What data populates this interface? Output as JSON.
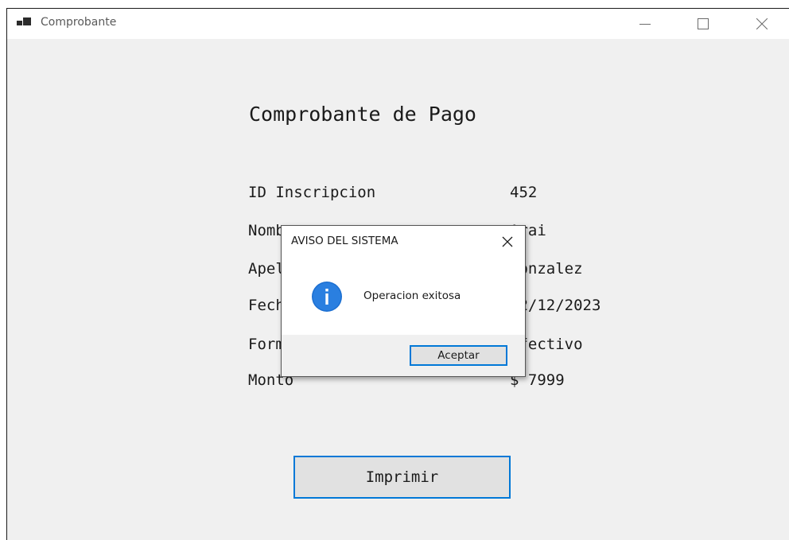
{
  "window": {
    "title": "Comprobante",
    "icon": "app-window-icon",
    "controls": [
      "minimize-icon",
      "maximize-icon",
      "close-icon"
    ]
  },
  "form": {
    "heading": "Comprobante de Pago",
    "fields": [
      {
        "label": "ID Inscripcion",
        "value": "452"
      },
      {
        "label": "Nombre",
        "value": "Arai"
      },
      {
        "label": "Apellido",
        "value": "Gonzalez"
      },
      {
        "label": "Fecha",
        "value": "12/12/2023"
      },
      {
        "label": "Forma de pago",
        "value": "Efectivo"
      },
      {
        "label": "Monto",
        "value": "$ 7999"
      }
    ],
    "print_button": "Imprimir"
  },
  "dialog": {
    "title": "AVISO DEL SISTEMA",
    "message": "Operacion exitosa",
    "icon": "info-icon",
    "ok_button": "Aceptar"
  },
  "colors": {
    "window_bg": "#f0f0f0",
    "accent": "#0078d7",
    "button_bg": "#e1e1e1"
  }
}
